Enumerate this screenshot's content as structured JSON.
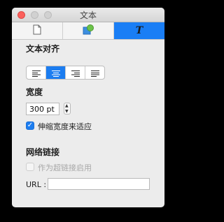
{
  "window": {
    "title": "文本"
  },
  "tabs": [
    {
      "icon": "document-icon"
    },
    {
      "icon": "shape-style-icon"
    },
    {
      "icon": "text-icon",
      "glyph": "T",
      "selected": true
    }
  ],
  "alignment": {
    "heading": "文本对齐",
    "options": [
      "align-left",
      "align-center",
      "align-right",
      "justify"
    ],
    "selected": "align-center"
  },
  "width": {
    "heading": "宽度",
    "value": "300 pt",
    "shrink_to_fit_label": "伸缩宽度来适应",
    "shrink_to_fit_checked": true
  },
  "hyperlink": {
    "heading": "网络链接",
    "enable_label": "作为超链接启用",
    "enable_checked": false,
    "url_label": "URL :",
    "url_value": ""
  },
  "colors": {
    "accent": "#1c7df0",
    "close": "#fc605c"
  }
}
